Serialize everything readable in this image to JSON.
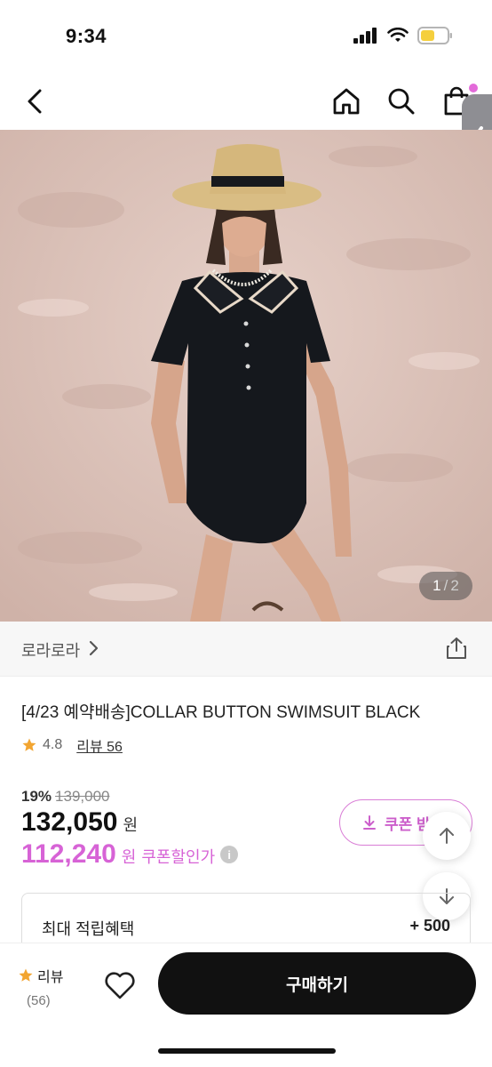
{
  "status_bar": {
    "time": "9:34",
    "battery_color": "#f5cf3d"
  },
  "nav": {
    "cart_badge_color": "#e36ad9"
  },
  "gallery": {
    "current": "1",
    "separator": "/",
    "total": "2"
  },
  "brand": {
    "name": "로라로라"
  },
  "product": {
    "title": "[4/23 예약배송]COLLAR BUTTON SWIMSUIT BLACK",
    "rating": "4.8",
    "review_label": "리뷰 56",
    "discount_pct": "19%",
    "original_price": "139,000",
    "price": "132,050",
    "currency": "원",
    "coupon_price": "112,240",
    "coupon_currency": "원",
    "coupon_note": "쿠폰할인가",
    "info_icon": "i"
  },
  "coupon_button": {
    "label": "쿠폰 받"
  },
  "benefit": {
    "label": "최대 적립혜택",
    "value": "+ 500"
  },
  "bottom_bar": {
    "review_label": "리뷰",
    "review_count": "(56)",
    "buy_label": "구매하기"
  },
  "colors": {
    "accent": "#d763d6",
    "star": "#f2a531",
    "buy_button": "#111111"
  }
}
